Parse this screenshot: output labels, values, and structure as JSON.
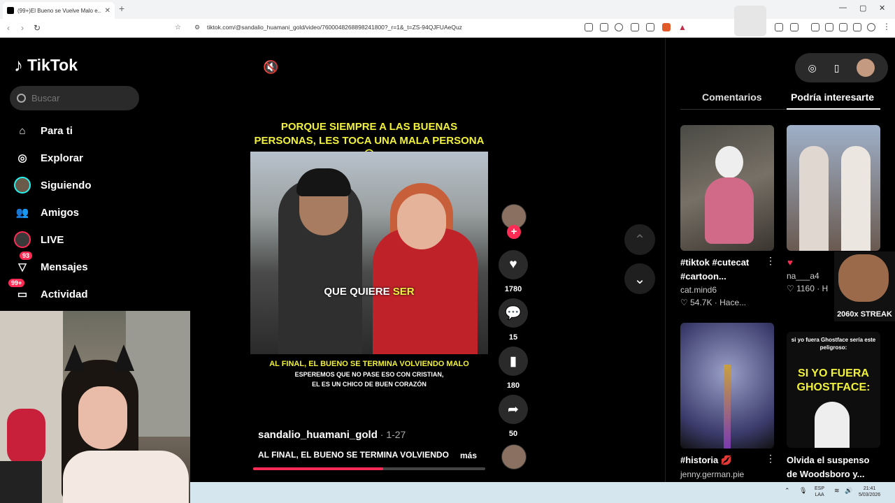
{
  "browser": {
    "tab_title": "(99+)El Bueno se Vuelve Malo e...",
    "new_tab": "+",
    "url": "tiktok.com/@sandalio_huamani_gold/video/7600048268898241800?_r=1&_t=ZS-94QJFUAeQuz"
  },
  "tiktok": {
    "logo_text": "TikTok",
    "search_placeholder": "Buscar",
    "menu": [
      {
        "label": "Para ti",
        "icon": "home-icon"
      },
      {
        "label": "Explorar",
        "icon": "compass-icon"
      },
      {
        "label": "Siguiendo",
        "icon": "following-avatar"
      },
      {
        "label": "Amigos",
        "icon": "friends-icon"
      },
      {
        "label": "LIVE",
        "icon": "live-avatar"
      },
      {
        "label": "Mensajes",
        "icon": "inbox-icon",
        "badge": "93"
      },
      {
        "label": "Actividad",
        "icon": "activity-icon",
        "badge": "99+"
      }
    ]
  },
  "video": {
    "caption_top": "PORQUE SIEMPRE A LAS BUENAS PERSONAS, LES TOCA UNA MALA PERSONA ☹",
    "subtitle_white": "QUE QUIERE ",
    "subtitle_yellow": "SER",
    "caption_bottom": "AL FINAL, EL BUENO SE TERMINA VOLVIENDO MALO",
    "caption_small_1": "ESPEREMOS QUE NO PASE ESO CON CRISTIAN,",
    "caption_small_2": "EL ES UN CHICO DE BUEN CORAZÓN",
    "author": "sandalio_huamani_gold",
    "date": " · 1-27",
    "description": "AL FINAL, EL BUENO SE TERMINA VOLVIENDO",
    "more": "más",
    "progress": 0.56
  },
  "actions": {
    "likes": "1780",
    "comments": "15",
    "saves": "180",
    "shares": "50"
  },
  "right_panel": {
    "tab_comments": "Comentarios",
    "tab_related": "Podría interesarte",
    "cards": [
      {
        "title_1": "#tiktok #cutecat",
        "title_2": "#cartoon...",
        "user": "cat.mind6",
        "meta": "♡ 54.7K · Hace..."
      },
      {
        "title_1": "♥",
        "title_2": "",
        "user": "na___a4",
        "meta": "♡ 1160 · H"
      },
      {
        "title_1": "#historia 💋",
        "title_2": "",
        "user": "jenny.german.pie",
        "meta": ""
      },
      {
        "title_1": "Olvida el suspenso",
        "title_2": "de Woodsboro y...",
        "user": "",
        "meta": ""
      }
    ],
    "ghostface_caption_small": "si yo fuera Ghostface sería este peligroso:",
    "ghostface_caption_big": "SI YO FUERA GHOSTFACE:",
    "streak_text": "2060x STREAK"
  },
  "taskbar": {
    "lang_1": "ESP",
    "lang_2": "LAA",
    "time": "21:41",
    "date": "5/03/2026"
  },
  "colors": {
    "accent": "#fe2c55",
    "caption_yellow": "#f1f13c",
    "teal": "#25f4ee"
  }
}
